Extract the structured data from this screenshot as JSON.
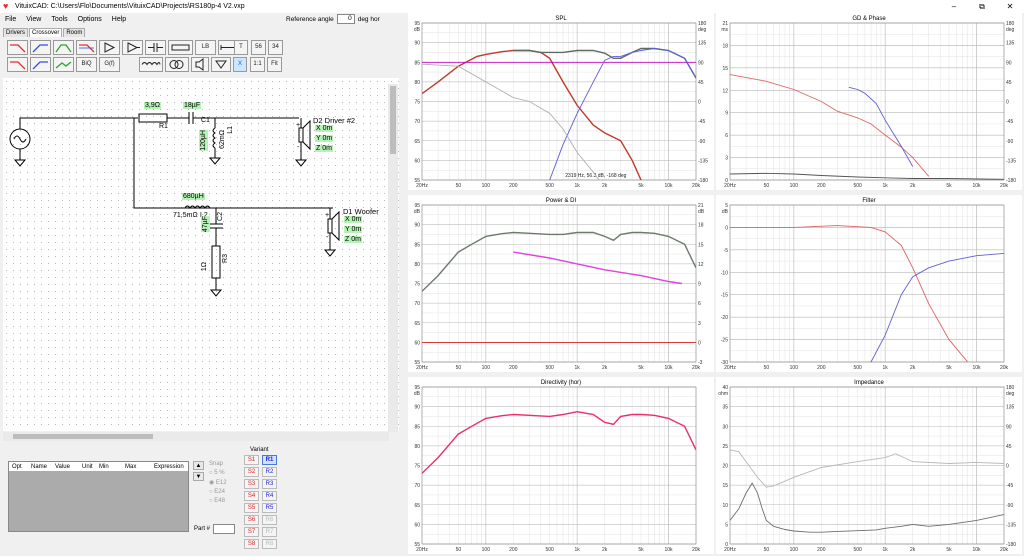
{
  "window": {
    "title": "VituixCAD: C:\\Users\\Flo\\Documents\\VituixCAD\\Projects\\RS180p-4 V2.vxp",
    "minimize": "–",
    "maximize": "⧉",
    "close": "✕"
  },
  "menu": [
    "File",
    "View",
    "Tools",
    "Options",
    "Help"
  ],
  "reference_angle": {
    "label": "Reference angle",
    "value": "0",
    "unit": "deg hor"
  },
  "tabs": [
    "Drivers",
    "Crossover",
    "Room"
  ],
  "toolbar": {
    "biq": "BiQ",
    "gf": "G(f)",
    "lb": "LB",
    "t": "T",
    "b56": "56",
    "b34": "34",
    "x": "X",
    "one": "1:1",
    "fit": "Fit"
  },
  "schematic": {
    "r1_value": "3,9Ω",
    "r1_name": "R1",
    "c1_value": "18µF",
    "c1_name": "C1",
    "l1_value": "120µH",
    "l1_res": "62mΩ",
    "l1_name": "L1",
    "d2_name": "D2 Driver #2",
    "d2_x": "X 0m",
    "d2_y": "Y 0m",
    "d2_z": "Z 0m",
    "l2_value": "680µH",
    "l2_res": "71,5mΩ",
    "l2_name": "L2",
    "c2_value": "47µF",
    "c2_name": "C2",
    "r3_value": "1Ω",
    "r3_name": "R3",
    "d1_name": "D1 Woofer",
    "d1_x": "X 0m",
    "d1_y": "Y 0m",
    "d1_z": "Z 0m",
    "plus": "+",
    "minus": "-"
  },
  "property_table": {
    "columns": [
      "Opt",
      "Name",
      "Value",
      "Unit",
      "Min",
      "Max",
      "Expression"
    ],
    "up": "▲",
    "down": "▼"
  },
  "snap": {
    "label": "Snap",
    "options": [
      "5 %",
      "E12",
      "E24",
      "E48"
    ]
  },
  "part_label": "Part #",
  "variant": {
    "label": "Variant",
    "left": [
      "S1",
      "S2",
      "S3",
      "S4",
      "S5",
      "S6",
      "S7",
      "S8"
    ],
    "right": [
      "R1",
      "R2",
      "R3",
      "R4",
      "R5",
      "R6",
      "R7",
      "R8"
    ]
  },
  "charts": {
    "spl": {
      "title": "SPL",
      "yunit": "dB",
      "yunit_r": "deg",
      "yticks": [
        "95",
        "90",
        "85",
        "80",
        "75",
        "70",
        "65",
        "60",
        "55"
      ],
      "rticks": [
        "180",
        "135",
        "90",
        "45",
        "0",
        "-45",
        "-90",
        "-135",
        "-180"
      ],
      "xticks": [
        "20Hz",
        "50",
        "100",
        "200",
        "500",
        "1k",
        "2k",
        "5k",
        "10k",
        "20k"
      ],
      "readout": "2319 Hz, 56.3 dB, -168 deg"
    },
    "gd": {
      "title": "GD & Phase",
      "yunit": "ms",
      "yunit_r": "deg",
      "yticks": [
        "21",
        "18",
        "15",
        "12",
        "9",
        "6",
        "3",
        "0"
      ],
      "rticks": [
        "180",
        "135",
        "90",
        "45",
        "0",
        "-45",
        "-90",
        "-135",
        "-180"
      ],
      "xticks": [
        "20Hz",
        "50",
        "100",
        "200",
        "500",
        "1k",
        "2k",
        "5k",
        "10k",
        "20k"
      ]
    },
    "power": {
      "title": "Power & DI",
      "yunit": "dB",
      "yunit_r": "dB",
      "yticks": [
        "95",
        "90",
        "85",
        "80",
        "75",
        "70",
        "65",
        "60",
        "55"
      ],
      "rticks": [
        "21",
        "18",
        "15",
        "12",
        "9",
        "6",
        "3",
        "0",
        "-3"
      ],
      "xticks": [
        "20Hz",
        "50",
        "100",
        "200",
        "500",
        "1k",
        "2k",
        "5k",
        "10k",
        "20k"
      ]
    },
    "filter": {
      "title": "Filter",
      "yunit": "dB",
      "yticks": [
        "5",
        "0",
        "-5",
        "-10",
        "-15",
        "-20",
        "-25",
        "-30"
      ],
      "xticks": [
        "20Hz",
        "50",
        "100",
        "200",
        "500",
        "1k",
        "2k",
        "5k",
        "10k",
        "20k"
      ]
    },
    "directivity": {
      "title": "Directivity (hor)",
      "yunit": "dB",
      "yticks": [
        "95",
        "90",
        "85",
        "80",
        "75",
        "70",
        "65",
        "60",
        "55"
      ],
      "xticks": [
        "20Hz",
        "50",
        "100",
        "200",
        "500",
        "1k",
        "2k",
        "5k",
        "10k",
        "20k"
      ]
    },
    "impedance": {
      "title": "Impedance",
      "yunit": "ohm",
      "yunit_r": "deg",
      "yticks": [
        "40",
        "35",
        "30",
        "25",
        "20",
        "15",
        "10",
        "5",
        "0"
      ],
      "rticks": [
        "180",
        "135",
        "90",
        "45",
        "0",
        "-45",
        "-90",
        "-135",
        "-180"
      ],
      "xticks": [
        "20Hz",
        "50",
        "100",
        "200",
        "500",
        "1k",
        "2k",
        "5k",
        "10k",
        "20k"
      ]
    }
  },
  "chart_data": [
    {
      "type": "line",
      "title": "SPL",
      "xlabel": "",
      "ylabel": "dB",
      "xscale": "log",
      "xlim": [
        20,
        20000
      ],
      "ylim": [
        55,
        95
      ],
      "grid": true,
      "series": [
        {
          "color": "#c0392b",
          "x": [
            20,
            30,
            50,
            80,
            100,
            150,
            200,
            300,
            400,
            500,
            700,
            1000,
            1500,
            2000,
            3000,
            4000,
            5000
          ],
          "y": [
            77,
            80,
            84,
            86.5,
            87,
            87.7,
            88,
            88,
            87.5,
            86,
            80,
            74,
            69,
            67,
            65,
            60,
            55
          ]
        },
        {
          "color": "#606a60",
          "x": [
            200,
            300,
            400,
            500,
            700,
            1000,
            1500,
            2000,
            2500,
            3000,
            4000,
            5000,
            7000,
            10000,
            15000,
            20000
          ],
          "y": [
            88,
            88,
            87.5,
            87.5,
            87.5,
            88,
            88,
            87.3,
            86,
            86,
            87.5,
            88.5,
            88.5,
            88,
            86,
            81
          ]
        },
        {
          "color": "#c000c0",
          "x": [
            20,
            20000
          ],
          "y": [
            85,
            85
          ]
        },
        {
          "color": "#5b5bdc",
          "x": [
            500,
            700,
            1000,
            1500,
            2000,
            2500,
            3000,
            4000,
            5000,
            7000,
            10000,
            15000,
            20000
          ],
          "y": [
            55,
            64,
            72,
            80,
            85.5,
            86.5,
            86.5,
            87.5,
            88,
            88.5,
            88,
            86,
            81
          ]
        },
        {
          "color": "#b0b0b0",
          "x": [
            20,
            50,
            100,
            200,
            300,
            500,
            700,
            1000,
            1500,
            2000,
            3000
          ],
          "y": [
            84.5,
            84,
            80,
            76,
            75,
            72,
            68,
            62,
            57,
            53,
            50
          ]
        }
      ]
    },
    {
      "type": "line",
      "title": "GD & Phase",
      "xlabel": "",
      "ylabel": "ms",
      "xscale": "log",
      "xlim": [
        20,
        20000
      ],
      "ylim": [
        0,
        21
      ],
      "grid": true,
      "series": [
        {
          "color": "#e0665f",
          "x": [
            20,
            50,
            100,
            200,
            300,
            500,
            700,
            1000,
            1500,
            2000,
            3000
          ],
          "y": [
            14.1,
            13.2,
            12.1,
            10.5,
            9.2,
            8.3,
            7.5,
            6.0,
            4.4,
            3.0,
            0.5
          ]
        },
        {
          "color": "#6060d0",
          "x": [
            400,
            500,
            600,
            800,
            1000,
            1500,
            2000
          ],
          "y": [
            12.4,
            12.1,
            11.6,
            10.2,
            8.0,
            4.5,
            1.8
          ]
        },
        {
          "color": "#555555",
          "x": [
            20,
            50,
            100,
            200,
            500,
            1000,
            2000,
            5000,
            20000
          ],
          "y": [
            0.8,
            0.9,
            0.8,
            0.6,
            0.4,
            0.3,
            0.2,
            0.2,
            0.1
          ]
        }
      ]
    },
    {
      "type": "line",
      "title": "Power & DI",
      "xlabel": "",
      "ylabel": "dB",
      "xscale": "log",
      "xlim": [
        20,
        20000
      ],
      "ylim": [
        55,
        95
      ],
      "grid": true,
      "series": [
        {
          "color": "#6b7a6b",
          "x": [
            20,
            30,
            50,
            70,
            100,
            150,
            200,
            300,
            500,
            700,
            1000,
            1500,
            2000,
            2500,
            3000,
            4000,
            5000,
            7000,
            10000,
            15000,
            20000
          ],
          "y": [
            73,
            77,
            83,
            85,
            87,
            87.7,
            88,
            87.8,
            87.5,
            87.5,
            88,
            88,
            87,
            86,
            87.5,
            88,
            88,
            87.8,
            87,
            85,
            79
          ]
        },
        {
          "color": "#dd44dd",
          "x": [
            200,
            500,
            1000,
            2000,
            5000,
            10000,
            14000
          ],
          "y": [
            83,
            81.5,
            80,
            78.5,
            77,
            75.5,
            75
          ]
        },
        {
          "color": "#dd2222",
          "x": [
            20,
            20000
          ],
          "y": [
            60,
            60
          ]
        }
      ]
    },
    {
      "type": "line",
      "title": "Filter",
      "xlabel": "",
      "ylabel": "dB",
      "xscale": "log",
      "xlim": [
        20,
        20000
      ],
      "ylim": [
        -30,
        5
      ],
      "grid": true,
      "series": [
        {
          "color": "#e06060",
          "x": [
            20,
            100,
            300,
            700,
            1000,
            1500,
            2000,
            3000,
            5000,
            8000
          ],
          "y": [
            0,
            0,
            0.4,
            0,
            -1,
            -4,
            -9,
            -17,
            -25,
            -30
          ]
        },
        {
          "color": "#6060d0",
          "x": [
            700,
            1000,
            1500,
            2000,
            3000,
            5000,
            10000,
            20000
          ],
          "y": [
            -30,
            -24,
            -15,
            -11,
            -9,
            -7.5,
            -6.3,
            -5.8
          ]
        }
      ]
    },
    {
      "type": "line",
      "title": "Directivity (hor)",
      "xlabel": "",
      "ylabel": "dB",
      "xscale": "log",
      "xlim": [
        20,
        20000
      ],
      "ylim": [
        55,
        95
      ],
      "grid": true,
      "series": [
        {
          "color": "#e8306a",
          "x": [
            20,
            30,
            50,
            70,
            100,
            150,
            200,
            300,
            500,
            700,
            1000,
            1500,
            2000,
            2500,
            3000,
            4000,
            5000,
            7000,
            10000,
            15000,
            20000
          ],
          "y": [
            73,
            77,
            83,
            85,
            87,
            87.7,
            88,
            87.8,
            87.5,
            88,
            88.7,
            88,
            86,
            85.5,
            87.5,
            88,
            88,
            87.8,
            87,
            85,
            79
          ]
        }
      ]
    },
    {
      "type": "line",
      "title": "Impedance",
      "xlabel": "",
      "ylabel": "ohm",
      "xscale": "log",
      "xlim": [
        20,
        20000
      ],
      "ylim": [
        0,
        40
      ],
      "grid": true,
      "series": [
        {
          "color": "#6e6e6e",
          "x": [
            20,
            25,
            30,
            35,
            40,
            45,
            50,
            60,
            80,
            100,
            150,
            200,
            300,
            500,
            800,
            1000,
            1500,
            2000,
            3000,
            5000,
            10000,
            20000
          ],
          "y": [
            6,
            9,
            13,
            15.5,
            13,
            9,
            6,
            4.5,
            3.7,
            3.3,
            3,
            3,
            3.2,
            3.4,
            3.6,
            4,
            4.5,
            5,
            4.5,
            5,
            6,
            7.5
          ]
        },
        {
          "color": "#b8b8b8",
          "x": [
            20,
            25,
            30,
            40,
            50,
            60,
            80,
            100,
            200,
            500,
            1000,
            1300,
            2000,
            5000,
            10000,
            20000
          ],
          "y": [
            24,
            23.5,
            21,
            17,
            14.5,
            14.8,
            16,
            17,
            19.5,
            21,
            22,
            23,
            21,
            20.5,
            20.8,
            20.5
          ]
        }
      ]
    }
  ]
}
